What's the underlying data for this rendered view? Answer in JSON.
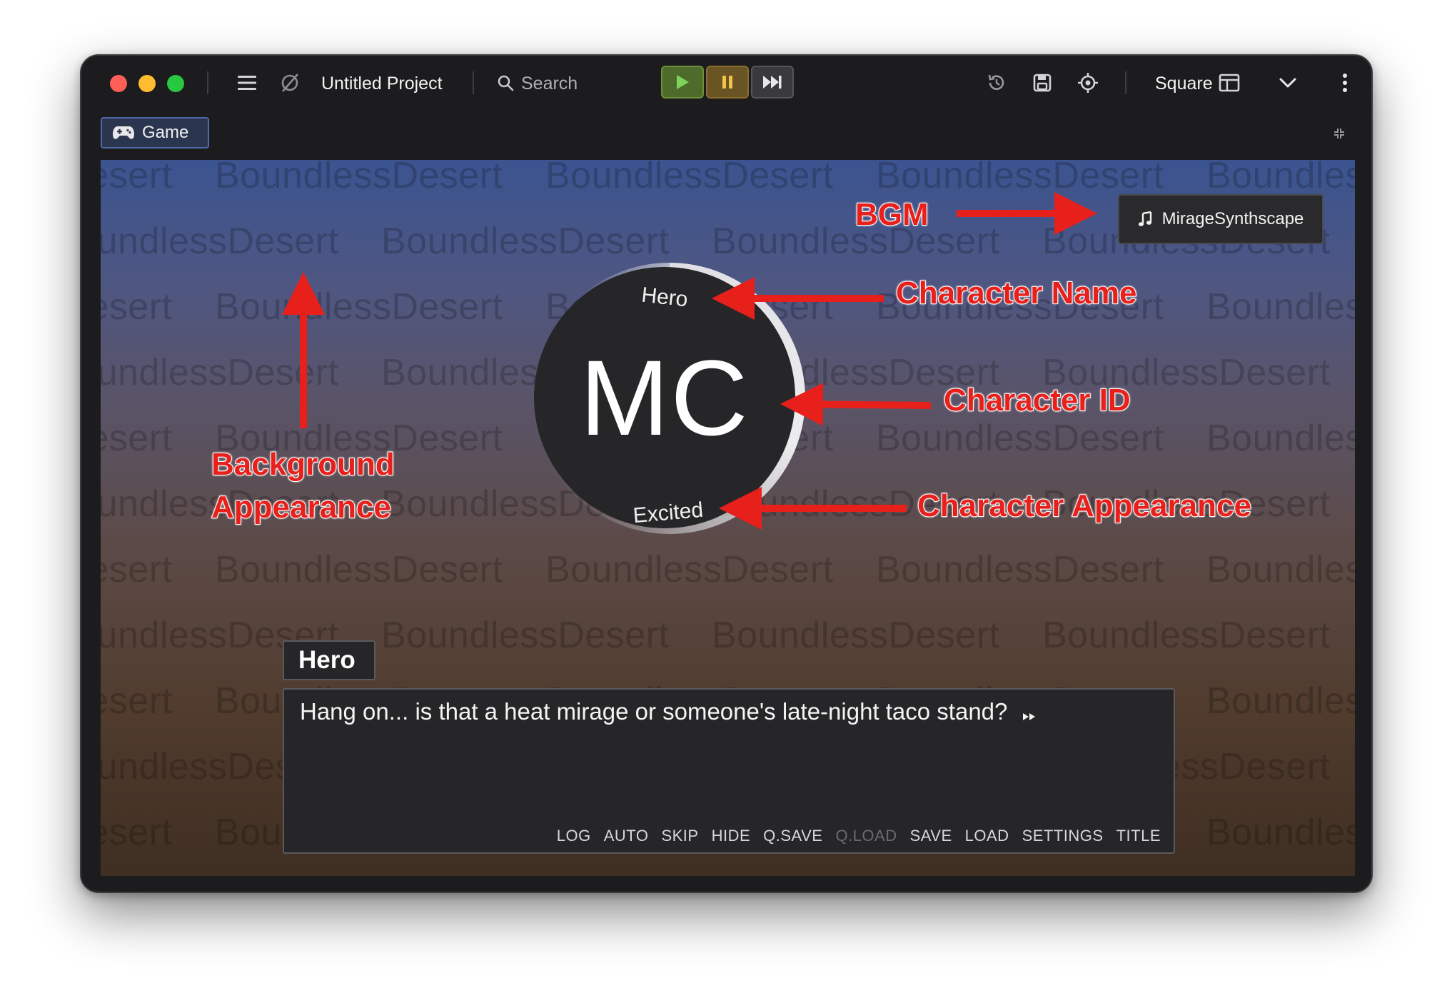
{
  "window": {
    "project_name": "Untitled Project",
    "search_placeholder": "Search",
    "layout_label": "Square",
    "icons": [
      "menu-icon",
      "no-project-icon",
      "search-icon",
      "play-icon",
      "pause-icon",
      "skip-forward-icon",
      "history-icon",
      "save-disk-icon",
      "crosshair-icon",
      "layout-panel-icon",
      "chevron-down-icon",
      "more-vertical-icon"
    ]
  },
  "tabs": {
    "game_label": "Game"
  },
  "scene": {
    "background_watermark": "BoundlessDesert",
    "bgm": "MirageSynthscape",
    "character": {
      "name": "Hero",
      "id": "MC",
      "appearance": "Excited"
    }
  },
  "dialogue": {
    "speaker": "Hero",
    "text": "Hang on... is that a heat mirage or someone's late-night taco stand?",
    "menu": [
      {
        "label": "LOG",
        "enabled": true
      },
      {
        "label": "AUTO",
        "enabled": true
      },
      {
        "label": "SKIP",
        "enabled": true
      },
      {
        "label": "HIDE",
        "enabled": true
      },
      {
        "label": "Q.SAVE",
        "enabled": true
      },
      {
        "label": "Q.LOAD",
        "enabled": false
      },
      {
        "label": "SAVE",
        "enabled": true
      },
      {
        "label": "LOAD",
        "enabled": true
      },
      {
        "label": "SETTINGS",
        "enabled": true
      },
      {
        "label": "TITLE",
        "enabled": true
      }
    ]
  },
  "annotations": {
    "bgm": "BGM",
    "character_name": "Character Name",
    "character_id": "Character ID",
    "character_appearance": "Character Appearance",
    "background_line1": "Background",
    "background_line2": "Appearance",
    "color": "#e8201c"
  }
}
